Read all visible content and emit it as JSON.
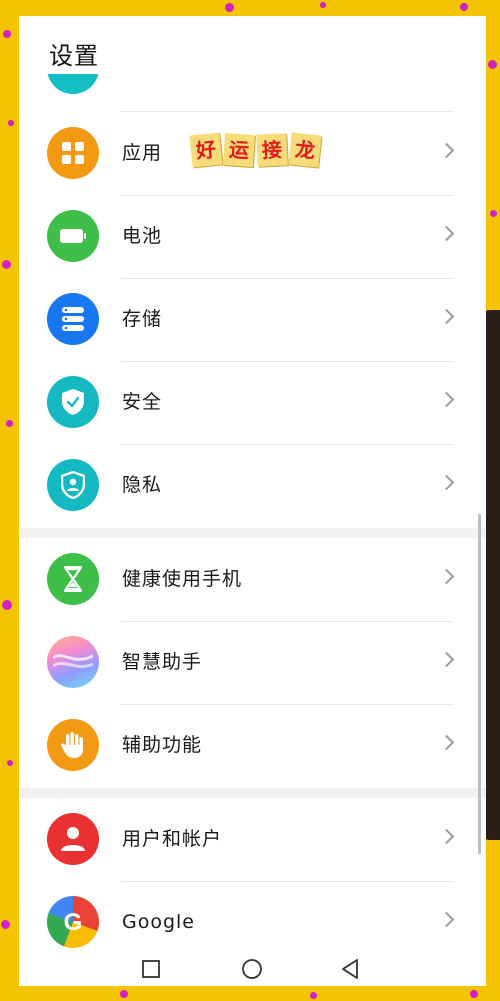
{
  "header": {
    "title": "设置"
  },
  "sticker": {
    "chars": [
      "好",
      "运",
      "接",
      "龙"
    ]
  },
  "settings_items": [
    {
      "label": "应用",
      "icon": "apps-grid-icon",
      "color": "#f39a12"
    },
    {
      "label": "电池",
      "icon": "battery-icon",
      "color": "#3fbf4a"
    },
    {
      "label": "存储",
      "icon": "storage-icon",
      "color": "#1677f0"
    },
    {
      "label": "安全",
      "icon": "security-shield-icon",
      "color": "#14b9c1"
    },
    {
      "label": "隐私",
      "icon": "privacy-icon",
      "color": "#14b9c1"
    },
    {
      "label": "健康使用手机",
      "icon": "hourglass-icon",
      "color": "#3fbf4a"
    },
    {
      "label": "智慧助手",
      "icon": "smart-assistant-icon",
      "color": "#a98cf5"
    },
    {
      "label": "辅助功能",
      "icon": "hand-icon",
      "color": "#f39a12"
    },
    {
      "label": "用户和帐户",
      "icon": "user-icon",
      "color": "#ea3030"
    },
    {
      "label": "Google",
      "icon": "google-icon",
      "color": "#4285f4"
    }
  ],
  "navbar": {
    "items": [
      "recent-apps-icon",
      "home-icon",
      "back-icon"
    ]
  }
}
